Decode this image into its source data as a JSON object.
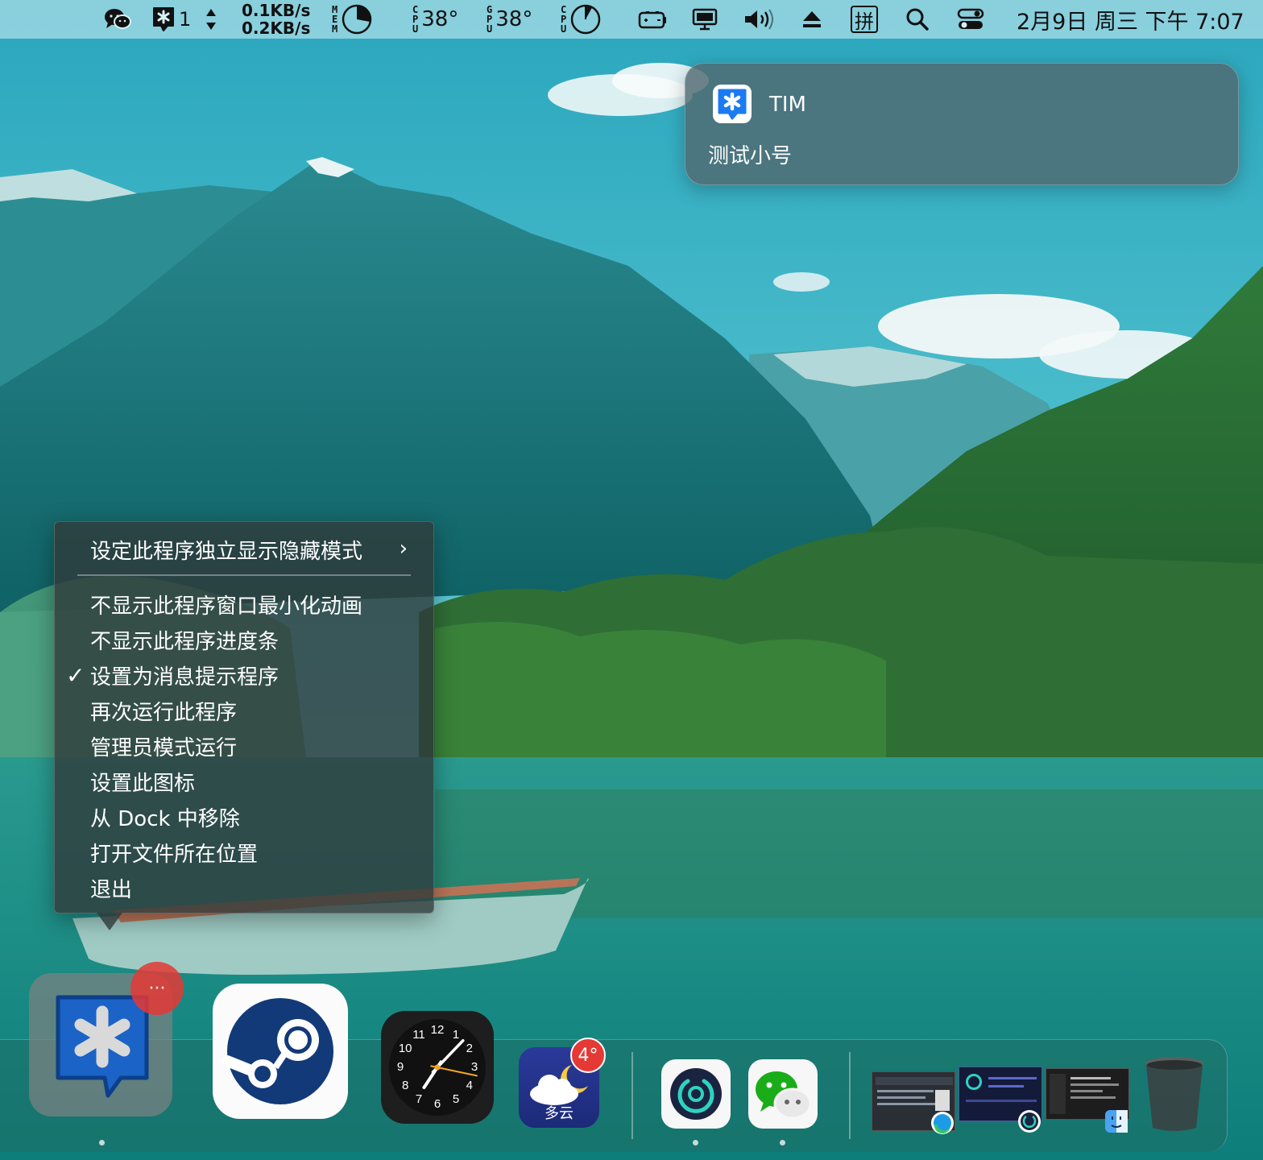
{
  "menubar": {
    "tim_unread": "1",
    "net_up": "0.1KB/s",
    "net_down": "0.2KB/s",
    "mem_label": [
      "M",
      "E",
      "M"
    ],
    "cpu_label": [
      "C",
      "P",
      "U"
    ],
    "gpu_label": [
      "G",
      "P",
      "U"
    ],
    "cpu_temp": "38°",
    "gpu_temp": "38°",
    "input_method": "拼",
    "datetime": "2月9日 周三 下午 7:07",
    "mem_usage_fraction": 0.28,
    "cpu_usage_fraction": 0.08,
    "icons": [
      "wechat-icon",
      "tim-icon",
      "network-arrows-icon",
      "mem-pie-icon",
      "cpu-pie-icon",
      "battery-icon",
      "display-icon",
      "volume-icon",
      "eject-icon",
      "input-method-icon",
      "search-icon",
      "control-center-icon"
    ]
  },
  "notification": {
    "app_name": "TIM",
    "message": "测试小号"
  },
  "context_menu": {
    "items": [
      {
        "label": "设定此程序独立显示隐藏模式",
        "submenu": true,
        "checked": false
      },
      {
        "label": "不显示此程序窗口最小化动画",
        "submenu": false,
        "checked": false
      },
      {
        "label": "不显示此程序进度条",
        "submenu": false,
        "checked": false
      },
      {
        "label": "设置为消息提示程序",
        "submenu": false,
        "checked": true
      },
      {
        "label": "再次运行此程序",
        "submenu": false,
        "checked": false
      },
      {
        "label": "管理员模式运行",
        "submenu": false,
        "checked": false
      },
      {
        "label": "设置此图标",
        "submenu": false,
        "checked": false
      },
      {
        "label": "从 Dock 中移除",
        "submenu": false,
        "checked": false
      },
      {
        "label": "打开文件所在位置",
        "submenu": false,
        "checked": false
      },
      {
        "label": "退出",
        "submenu": false,
        "checked": false
      }
    ],
    "check_mark": "✓",
    "submenu_arrow": "›"
  },
  "dock": {
    "apps": [
      {
        "name": "TIM",
        "badge": "···",
        "running": true
      },
      {
        "name": "Steam",
        "running": false
      },
      {
        "name": "Clock",
        "running": false
      },
      {
        "name": "Weather",
        "badge": "4°",
        "label": "多云",
        "running": false
      },
      {
        "name": "Power",
        "running": true
      },
      {
        "name": "WeChat",
        "running": true
      }
    ],
    "clock_numbers": [
      "12",
      "1",
      "2",
      "3",
      "4",
      "5",
      "6",
      "7",
      "8",
      "9",
      "10",
      "11"
    ],
    "clock_time": {
      "hour": 7,
      "minute": 7,
      "second": 17
    },
    "minimized_windows": [
      "edge-window",
      "power-window",
      "explorer-window"
    ],
    "trash": "trash-icon"
  },
  "colors": {
    "tim_blue": "#1B7BF2",
    "steam_navy": "#123A79",
    "badge_red": "#E53935",
    "wechat_green": "#1AAD19",
    "menubar_bg": "#D7F0F5"
  }
}
